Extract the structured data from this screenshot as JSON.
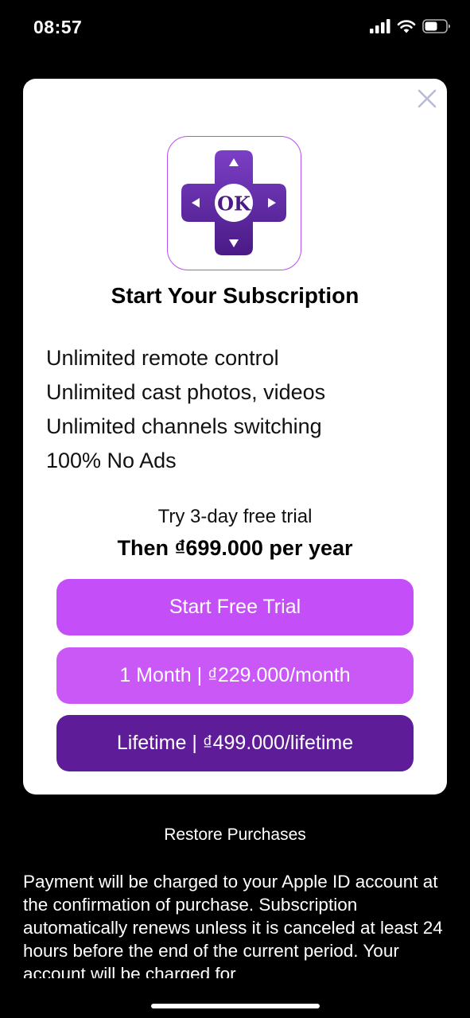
{
  "status_bar": {
    "time": "08:57",
    "icons": [
      "cellular-signal-icon",
      "wifi-icon",
      "battery-icon"
    ]
  },
  "paywall": {
    "close_icon": "close-icon",
    "logo": {
      "icon": "remote-dpad-icon",
      "center_text": "OK",
      "colors": {
        "border": "#b451f0",
        "pad_top": "#7b3fc6",
        "pad_bottom": "#4a1a86"
      }
    },
    "title": "Start Your Subscription",
    "features": [
      "Unlimited remote control",
      "Unlimited cast photos, videos",
      "Unlimited channels switching",
      "100% No Ads"
    ],
    "trial_text": "Try 3-day free trial",
    "price_text": "Then ₫699.000 per year",
    "buttons": {
      "trial": "Start Free Trial",
      "month": "1 Month | ₫229.000/month",
      "lifetime": "Lifetime | ₫499.000/lifetime"
    },
    "colors": {
      "trial_button": "#c44ef8",
      "month_button": "#ca58f6",
      "lifetime_button": "#5e1c98"
    }
  },
  "restore_label": "Restore Purchases",
  "legal_text": "Payment will be charged to your Apple ID account at the confirmation of purchase. Subscription automatically renews unless it is canceled at least 24 hours before the end of the current period. Your account will be charged for"
}
